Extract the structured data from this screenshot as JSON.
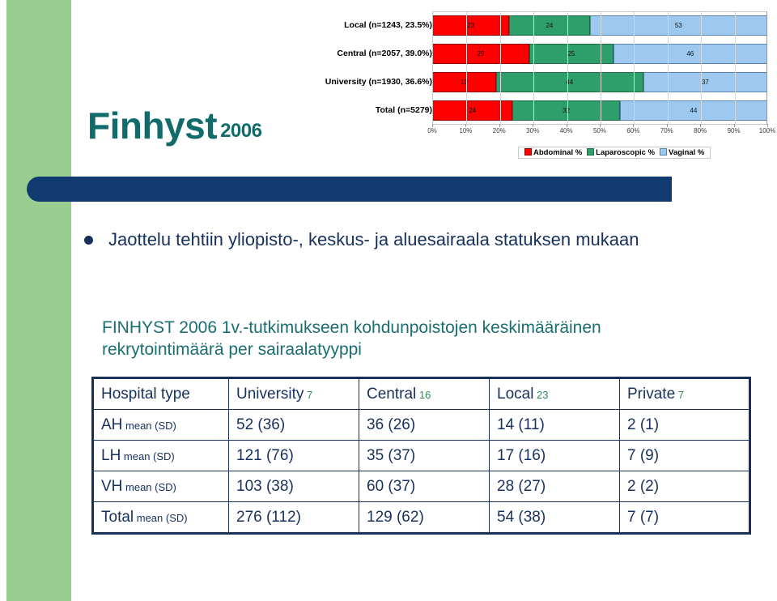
{
  "slide": {
    "title_main": "Finhyst",
    "title_year": "2006",
    "bullet_text": "Jaottelu tehtiin yliopisto-, keskus- ja aluesairaala statuksen mukaan",
    "section_heading": "FINHYST 2006 1v.-tutkimukseen kohdunpoistojen keskimääräinen rekrytointimäärä per sairaalatyyppi"
  },
  "colors": {
    "green_panel": "#9ACD91",
    "navy_bar": "#103A70",
    "title_teal": "#126B6B",
    "heading_teal": "#1B6E72",
    "text_navy": "#17305C",
    "abdominal": "#FF0000",
    "laparoscopic": "#2E9E6B",
    "vaginal": "#9DC8EF"
  },
  "chart_data": {
    "type": "bar",
    "orientation": "horizontal",
    "stacked": true,
    "title": "",
    "xlabel": "",
    "ylabel": "",
    "xlim": [
      0,
      100
    ],
    "grid": true,
    "legend_position": "bottom",
    "categories": [
      "Local (n=1243, 23.5%)",
      "Central (n=2057, 39.0%)",
      "University (n=1930, 36.6%)",
      "Total (n=5279)"
    ],
    "series": [
      {
        "name": "Abdominal  %",
        "color": "#FF0000",
        "values": [
          23,
          29,
          19,
          24
        ]
      },
      {
        "name": "Laparoscopic %",
        "color": "#2E9E6B",
        "values": [
          24,
          25,
          44,
          32
        ]
      },
      {
        "name": "Vaginal %",
        "color": "#9DC8EF",
        "values": [
          53,
          46,
          37,
          44
        ]
      }
    ],
    "xticks": [
      "0%",
      "10%",
      "20%",
      "30%",
      "40%",
      "50%",
      "60%",
      "70%",
      "80%",
      "90%",
      "100%"
    ]
  },
  "table": {
    "headers": [
      {
        "label": "Hospital type",
        "sub": ""
      },
      {
        "label": "University",
        "sub": "7"
      },
      {
        "label": "Central",
        "sub": "16"
      },
      {
        "label": "Local",
        "sub": "23"
      },
      {
        "label": "Private",
        "sub": "7"
      }
    ],
    "rows": [
      {
        "label": "AH",
        "sub": "mean (SD)",
        "cells": [
          "52 (36)",
          "36 (26)",
          "14 (11)",
          "2 (1)"
        ]
      },
      {
        "label": "LH",
        "sub": "mean (SD)",
        "cells": [
          "121 (76)",
          "35 (37)",
          "17 (16)",
          "7 (9)"
        ]
      },
      {
        "label": "VH",
        "sub": "mean (SD)",
        "cells": [
          "103 (38)",
          "60 (37)",
          "28 (27)",
          "2 (2)"
        ]
      },
      {
        "label": "Total",
        "sub": "mean (SD)",
        "cells": [
          "276 (112)",
          "129 (62)",
          "54 (38)",
          "7 (7)"
        ]
      }
    ]
  }
}
